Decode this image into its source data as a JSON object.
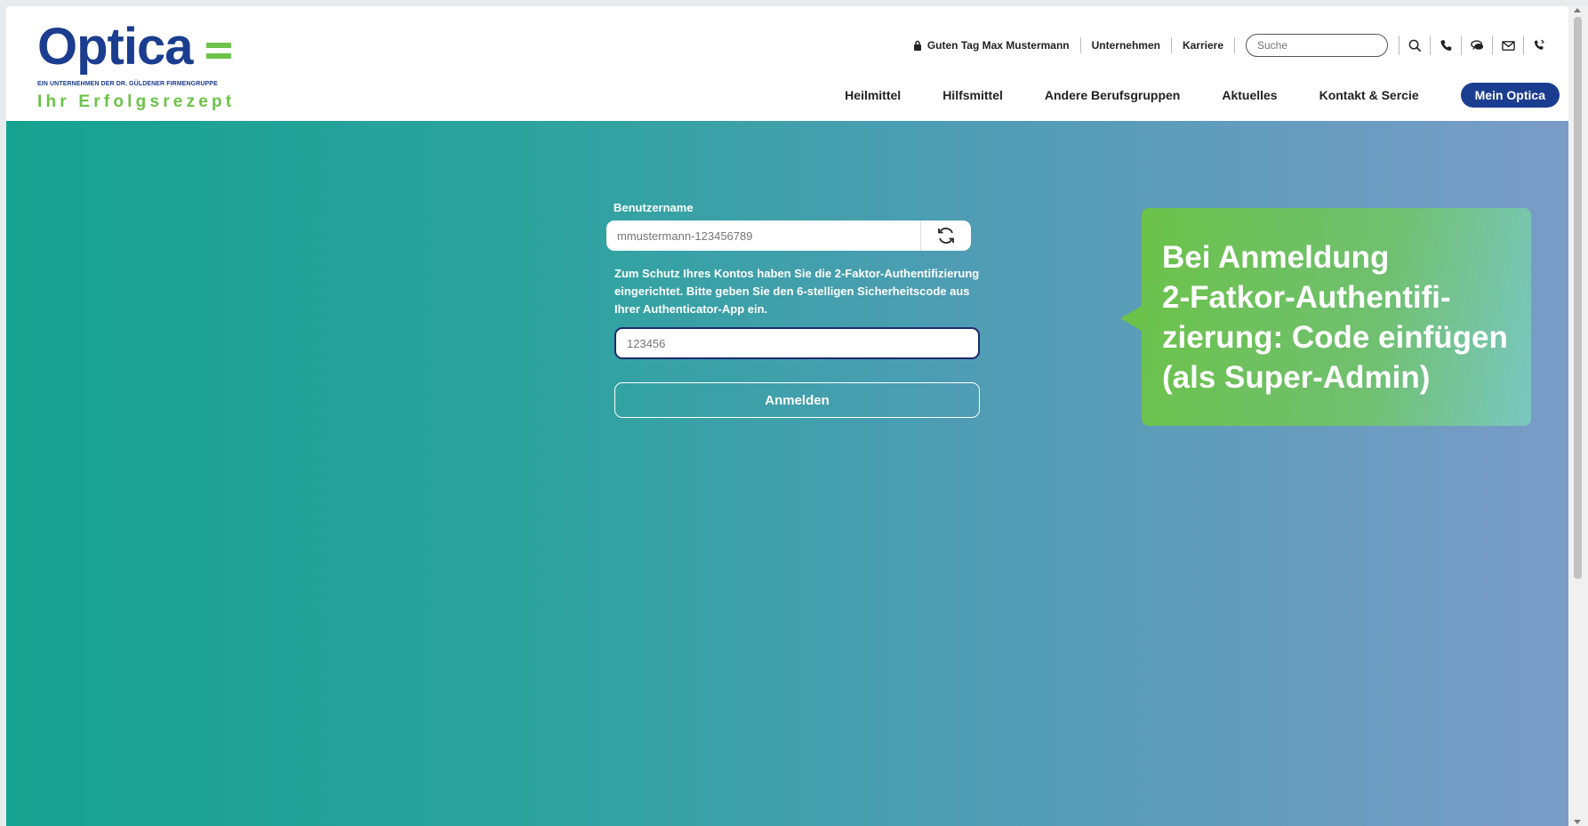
{
  "logo": {
    "wordmark": "Optica",
    "subline": "EIN UNTERNEHMEN DER DR. GÜLDENER FIRMENGRUPPE",
    "slogan": "Ihr Erfolgsrezept",
    "brand_color": "#1b3d8f",
    "accent_color": "#6cc24a"
  },
  "topbar": {
    "greeting": "Guten Tag Max Mustermann",
    "links": [
      "Unternehmen",
      "Karriere"
    ],
    "search_placeholder": "Suche",
    "icons": [
      "search-icon",
      "phone-icon",
      "chat-icon",
      "mail-icon",
      "emergency-phone-icon"
    ]
  },
  "nav": {
    "items": [
      "Heilmittel",
      "Hilfsmittel",
      "Andere Berufsgruppen",
      "Aktuelles",
      "Kontakt & Sercie"
    ],
    "cta": "Mein Optica"
  },
  "form": {
    "username_label": "Benutzername",
    "username_placeholder": "mmustermann-123456789",
    "note": "Zum Schutz Ihres Kontos haben Sie die 2-Faktor-Authentifizierung eingerichtet. Bitte geben Sie den 6-stelligen Sicherheitscode aus Ihrer Authenticator-App ein.",
    "code_placeholder": "123456",
    "submit_label": "Anmelden"
  },
  "callout": {
    "lines": [
      "Bei Anmeldung",
      "2-Fatkor-Authentifi-",
      "zierung: Code einfügen",
      "(als Super-Admin)"
    ]
  }
}
